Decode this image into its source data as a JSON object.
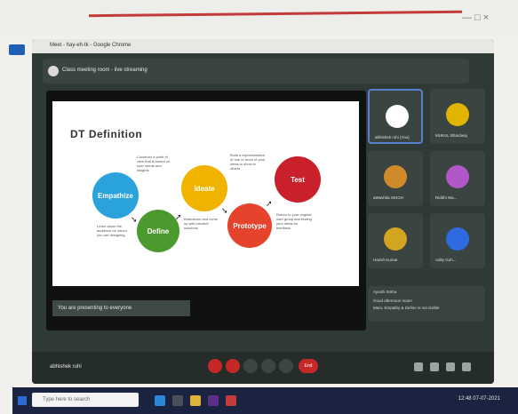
{
  "browser": {
    "tab_title": "Meet - hay-eh-tk - Google Chrome",
    "window_controls": "— □ ×"
  },
  "meeting": {
    "title": "Class meeting room - live streaming",
    "presenter_caption": "You are presenting to everyone",
    "current_user": "abhishek ruhi"
  },
  "slide": {
    "title": "DT Definition",
    "stages": [
      "Empathize",
      "Define",
      "Ideate",
      "Prototype",
      "Test"
    ],
    "stage_notes": [
      "Learn about the audience for whom you are designing",
      "Construct a point of view that is based on user needs and insights",
      "Brainstorm and come up with creative solutions",
      "Build a representation of one or more of your ideas to show to others",
      "Return to your original user group and testing your ideas for feedback"
    ]
  },
  "participants": [
    {
      "name": "abhishek ruhi (You)",
      "color": "#ffffff"
    },
    {
      "name": "MUKUL Bhardwaj",
      "color": "#e0b400"
    },
    {
      "name": "aWashita SINGH",
      "color": "#d08a2a"
    },
    {
      "name": "Riddhi Wa...",
      "color": "#b157c8"
    },
    {
      "name": "Harish Kumar",
      "color": "#d1a51f"
    },
    {
      "name": "Adity Guh...",
      "color": "#2f6be0"
    }
  ],
  "chat": {
    "author": "Ayushi Sinha",
    "lines": [
      "Good afternoon mam!",
      "Mam, Empathy & Define is not visible"
    ]
  },
  "controls": {
    "end_label": "End"
  },
  "taskbar": {
    "search_placeholder": "Type here to search",
    "time": "12:48",
    "date": "07-07-2021"
  },
  "colors": {
    "accent_red": "#c62828",
    "tile_bg": "#3a4440"
  }
}
